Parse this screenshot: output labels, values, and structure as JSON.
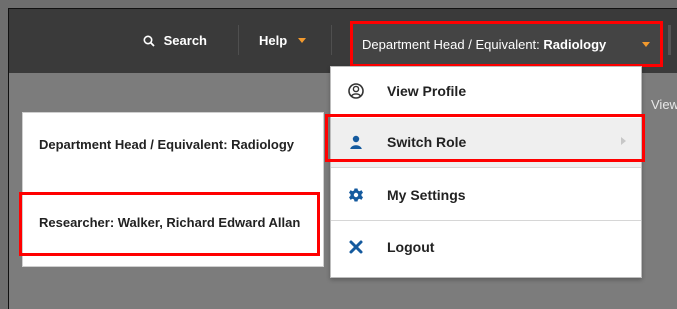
{
  "header": {
    "search_label": "Search",
    "help_label": "Help",
    "role_prefix": "Department Head / Equivalent:",
    "role_name": "Radiology"
  },
  "menu": {
    "items": [
      {
        "label": "View Profile",
        "icon": "profile-icon"
      },
      {
        "label": "Switch Role",
        "icon": "user-icon"
      },
      {
        "label": "My Settings",
        "icon": "gear-icon"
      },
      {
        "label": "Logout",
        "icon": "close-icon"
      }
    ]
  },
  "roles": {
    "items": [
      {
        "label": "Department Head / Equivalent: Radiology"
      },
      {
        "label": "Researcher: Walker, Richard Edward Allan"
      }
    ]
  },
  "right_text": "View",
  "colors": {
    "topbar": "#3a3a3a",
    "background": "#7c7c7c",
    "accent_orange": "#f29a2e",
    "highlight_red": "#ff0000",
    "icon_blue": "#145a9e"
  }
}
